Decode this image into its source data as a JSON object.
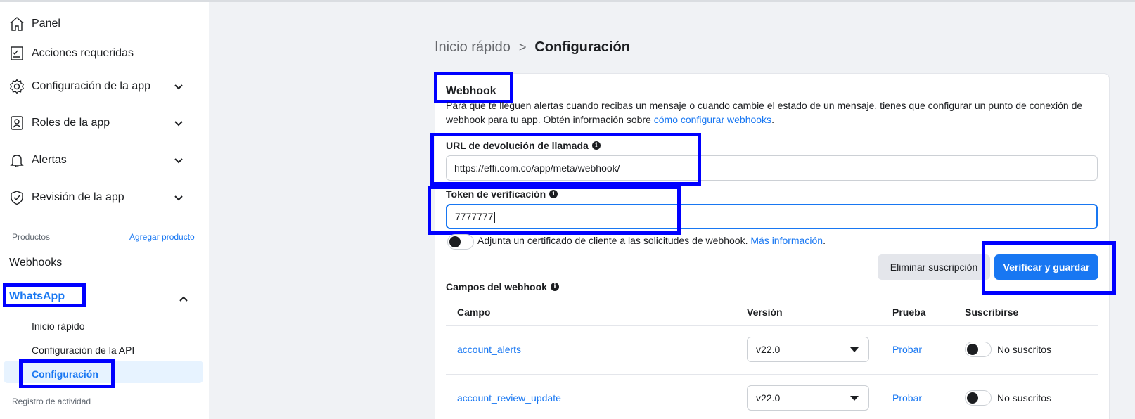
{
  "sidebar": {
    "items": [
      {
        "label": "Panel",
        "icon": "home-icon"
      },
      {
        "label": "Acciones requeridas",
        "icon": "checklist-icon"
      },
      {
        "label": "Configuración de la app",
        "icon": "gear-icon"
      },
      {
        "label": "Roles de la app",
        "icon": "user-badge-icon"
      },
      {
        "label": "Alertas",
        "icon": "bell-icon"
      },
      {
        "label": "Revisión de la app",
        "icon": "shield-check-icon"
      }
    ],
    "products_label": "Productos",
    "add_product": "Agregar producto",
    "webhooks": "Webhooks",
    "whatsapp": "WhatsApp",
    "whatsapp_sub": [
      "Inicio rápido",
      "Configuración de la API",
      "Configuración"
    ],
    "activity_log": "Registro de actividad"
  },
  "breadcrumb": {
    "parent": "Inicio rápido",
    "separator": ">",
    "current": "Configuración"
  },
  "webhook": {
    "title": "Webhook",
    "description": "Para que te lleguen alertas cuando recibas un mensaje o cuando cambie el estado de un mensaje, tienes que configurar un punto de conexión de webhook para tu app. Obtén información sobre",
    "description_link": "cómo configurar webhooks",
    "description_end": ".",
    "callback_label": "URL de devolución de llamada",
    "callback_value": "https://effi.com.co/app/meta/webhook/",
    "token_label": "Token de verificación",
    "token_value": "7777777",
    "cert_text": "Adjunta un certificado de cliente a las solicitudes de webhook.",
    "cert_link": "Más información",
    "cert_end": ".",
    "remove_button": "Eliminar suscripción",
    "verify_button": "Verificar y guardar"
  },
  "fields": {
    "title": "Campos del webhook",
    "columns": [
      "Campo",
      "Versión",
      "Prueba",
      "Suscribirse"
    ],
    "rows": [
      {
        "field": "account_alerts",
        "version": "v22.0",
        "test": "Probar",
        "status": "No suscritos"
      },
      {
        "field": "account_review_update",
        "version": "v22.0",
        "test": "Probar",
        "status": "No suscritos"
      }
    ]
  },
  "colors": {
    "accent": "#1877f2",
    "annotation": "#0000ff",
    "active_bg": "#e7f3ff"
  }
}
